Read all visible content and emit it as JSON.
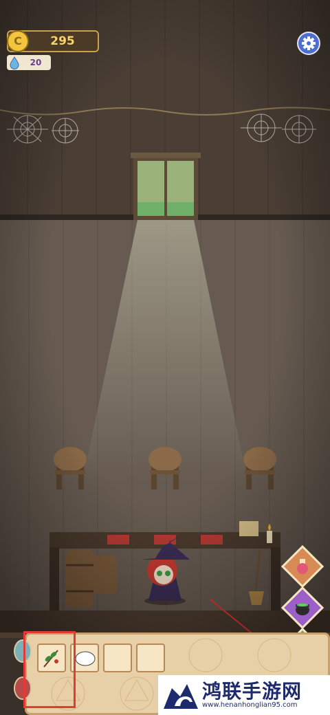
{
  "hud": {
    "coins": "295",
    "gems": "20",
    "coin_icon": "coin-icon",
    "gem_icon": "water-drop-icon",
    "settings_icon": "gear-icon"
  },
  "side_buttons": [
    {
      "name": "potion-shelf",
      "icon": "potion-icon",
      "color": "#d88a55"
    },
    {
      "name": "cauldron",
      "icon": "cauldron-icon",
      "color": "#9b5fc7"
    },
    {
      "name": "garden",
      "icon": "plant-box-icon",
      "color": "#4fae52"
    }
  ],
  "inventory": {
    "slots": [
      {
        "item": "herb-branch-icon",
        "filled": true
      },
      {
        "item": "",
        "filled": false
      },
      {
        "item": "",
        "filled": false
      },
      {
        "item": "",
        "filled": false
      }
    ]
  },
  "watermark": {
    "title": "鸿联手游网",
    "url": "www.henanhonglian95.com"
  },
  "colors": {
    "coin": "#f2c53d",
    "highlight": "#e53935",
    "wall": "#4b3f36",
    "floor": "#6b5f55"
  }
}
